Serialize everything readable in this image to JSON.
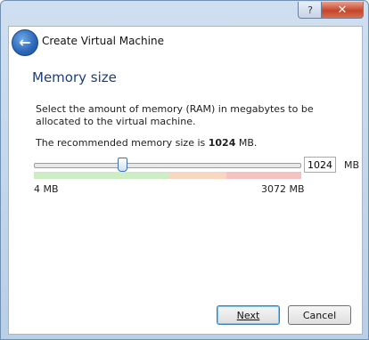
{
  "window": {
    "title": "Create Virtual Machine",
    "help_label": "?",
    "close_label": "✕"
  },
  "header": {
    "back_icon": "back-arrow-icon"
  },
  "page": {
    "title": "Memory size",
    "description": "Select the amount of memory (RAM) in megabytes to be allocated to the virtual machine.",
    "recommended_prefix": "The recommended memory size is ",
    "recommended_value": "1024",
    "recommended_suffix": " MB."
  },
  "memory": {
    "slider_min_label": "4 MB",
    "slider_max_label": "3072 MB",
    "value": "1024",
    "unit": "MB",
    "slider_fraction": 0.332
  },
  "buttons": {
    "next_label": "Next",
    "cancel_label": "Cancel"
  },
  "colors": {
    "title_bar": "#b9cfe6",
    "accent": "#1e3d7b",
    "zone_green": "#cdeec4",
    "zone_orange": "#f7d7bf",
    "zone_red": "#f6c1c1"
  }
}
